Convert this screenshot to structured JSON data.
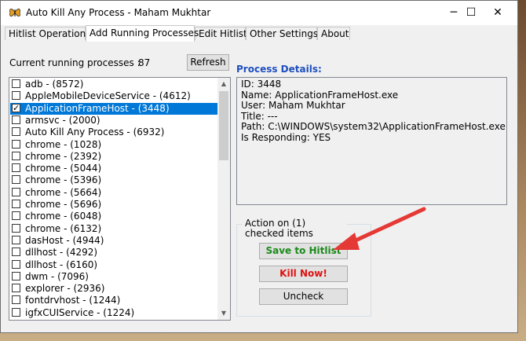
{
  "window": {
    "title": "Auto Kill Any Process - Maham Mukhtar",
    "minimize": "─",
    "maximize": "☐",
    "close": "✕"
  },
  "tabs": [
    {
      "label": "Hitlist Operations"
    },
    {
      "label": "Add Running Processes"
    },
    {
      "label": "Edit Hitlist"
    },
    {
      "label": "Other Settings"
    },
    {
      "label": "About"
    }
  ],
  "running": {
    "label": "Current running processes :",
    "count": "87",
    "refresh": "Refresh"
  },
  "processes": [
    {
      "label": "adb - (8572)",
      "checked": false
    },
    {
      "label": "AppleMobileDeviceService - (4612)",
      "checked": false
    },
    {
      "label": "ApplicationFrameHost - (3448)",
      "checked": true,
      "selected": true
    },
    {
      "label": "armsvc - (2000)",
      "checked": false
    },
    {
      "label": "Auto Kill Any Process - (6932)",
      "checked": false
    },
    {
      "label": "chrome - (1028)",
      "checked": false
    },
    {
      "label": "chrome - (2392)",
      "checked": false
    },
    {
      "label": "chrome - (5044)",
      "checked": false
    },
    {
      "label": "chrome - (5396)",
      "checked": false
    },
    {
      "label": "chrome - (5664)",
      "checked": false
    },
    {
      "label": "chrome - (5696)",
      "checked": false
    },
    {
      "label": "chrome - (6048)",
      "checked": false
    },
    {
      "label": "chrome - (6132)",
      "checked": false
    },
    {
      "label": "dasHost - (4944)",
      "checked": false
    },
    {
      "label": "dllhost - (4292)",
      "checked": false
    },
    {
      "label": "dllhost - (6160)",
      "checked": false
    },
    {
      "label": "dwm - (7096)",
      "checked": false
    },
    {
      "label": "explorer - (2936)",
      "checked": false
    },
    {
      "label": "fontdrvhost - (1244)",
      "checked": false
    },
    {
      "label": "igfxCUIService - (1224)",
      "checked": false
    }
  ],
  "details": {
    "title": "Process Details:",
    "lines": [
      "ID: 3448",
      "Name: ApplicationFrameHost.exe",
      "User: Maham Mukhtar",
      "Title: ---",
      "Path: C:\\WINDOWS\\system32\\ApplicationFrameHost.exe",
      "Is Responding: YES"
    ]
  },
  "action": {
    "group_label": "Action on (1) checked items",
    "save": "Save to Hitlist",
    "kill": "Kill Now!",
    "uncheck": "Uncheck"
  },
  "colors": {
    "accent": "#0078d7",
    "details_title": "#1e4fbf",
    "save_text": "#1a8a1a",
    "kill_text": "#e01010",
    "arrow": "#e53935"
  }
}
